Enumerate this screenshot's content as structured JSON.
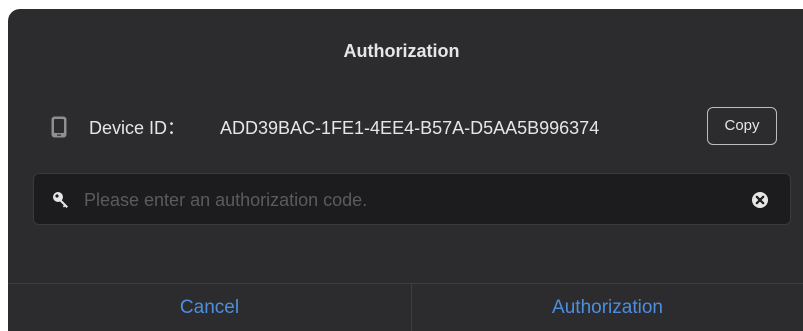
{
  "dialog": {
    "title": "Authorization",
    "device": {
      "label": "Device ID：",
      "value": "ADD39BAC-1FE1-4EE4-B57A-D5AA5B996374",
      "icon": "phone-icon",
      "copy_label": "Copy"
    },
    "input": {
      "value": "",
      "placeholder": "Please enter an authorization code.",
      "leading_icon": "key-icon",
      "trailing_icon": "clear-icon"
    },
    "footer": {
      "cancel_label": "Cancel",
      "confirm_label": "Authorization"
    }
  },
  "colors": {
    "background": "#2c2c2e",
    "input_background": "#1c1c1e",
    "text": "#e6e6e6",
    "placeholder": "#5b5b5e",
    "accent": "#4d8ee0",
    "divider": "#3d3d40"
  }
}
